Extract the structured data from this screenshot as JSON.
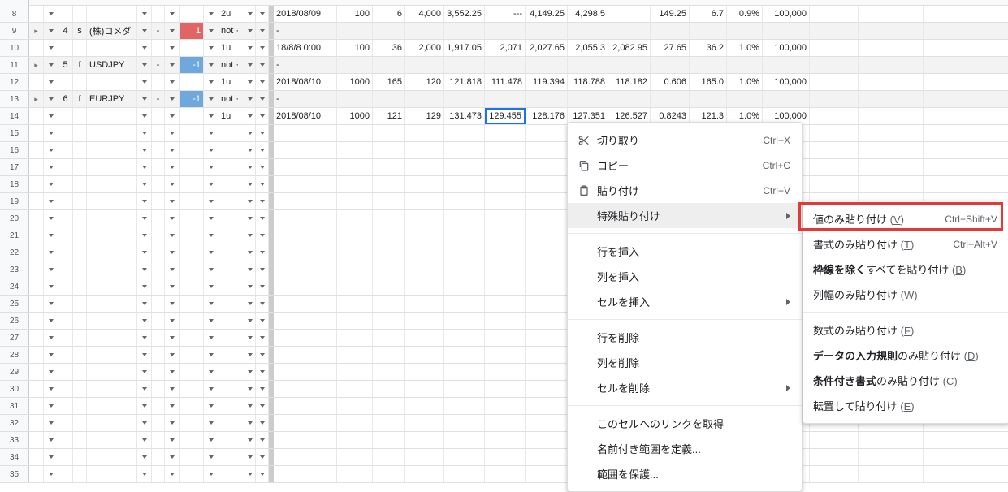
{
  "rows": [
    {
      "num": "8",
      "grey": false,
      "group": false,
      "id": "",
      "type": "",
      "sym": "",
      "bar": "",
      "pos": "",
      "posCls": "",
      "notCell1": false,
      "unit": "2u",
      "date": "2018/08/09",
      "v1": "100",
      "v2": "6",
      "v3": "4,000",
      "v4": "3,552.25",
      "v5": "---",
      "v6": "4,149.25",
      "v7": "4,298.5",
      "v8": "",
      "v9": "149.25",
      "v10": "6.7",
      "v11": "0.9%",
      "v12": "100,000"
    },
    {
      "num": "9",
      "grey": true,
      "group": true,
      "id": "4",
      "type": "s",
      "sym": "(株)コメダ",
      "bar": "-",
      "pos": "1",
      "posCls": "bg-red",
      "notCell1": true,
      "unit": "",
      "date": "-",
      "v1": "",
      "v2": "",
      "v3": "",
      "v4": "",
      "v5": "",
      "v6": "",
      "v7": "",
      "v8": "",
      "v9": "",
      "v10": "",
      "v11": "",
      "v12": ""
    },
    {
      "num": "10",
      "grey": false,
      "group": false,
      "id": "",
      "type": "",
      "sym": "",
      "bar": "",
      "pos": "",
      "posCls": "",
      "notCell1": false,
      "unit": "1u",
      "date": "18/8/8 0:00",
      "v1": "100",
      "v2": "36",
      "v3": "2,000",
      "v4": "1,917.05",
      "v5": "2,071",
      "v6": "2,027.65",
      "v7": "2,055.3",
      "v8": "2,082.95",
      "v9": "27.65",
      "v10": "36.2",
      "v11": "1.0%",
      "v12": "100,000"
    },
    {
      "num": "11",
      "grey": true,
      "group": true,
      "id": "5",
      "type": "f",
      "sym": "USDJPY",
      "bar": "-",
      "pos": "-1",
      "posCls": "bg-blue",
      "notCell1": true,
      "unit": "",
      "date": "-",
      "v1": "",
      "v2": "",
      "v3": "",
      "v4": "",
      "v5": "",
      "v6": "",
      "v7": "",
      "v8": "",
      "v9": "",
      "v10": "",
      "v11": "",
      "v12": ""
    },
    {
      "num": "12",
      "grey": false,
      "group": false,
      "id": "",
      "type": "",
      "sym": "",
      "bar": "",
      "pos": "",
      "posCls": "",
      "notCell1": false,
      "unit": "1u",
      "date": "2018/08/10",
      "v1": "1000",
      "v2": "165",
      "v3": "120",
      "v4": "121.818",
      "v5": "111.478",
      "v6": "119.394",
      "v7": "118.788",
      "v8": "118.182",
      "v9": "0.606",
      "v10": "165.0",
      "v11": "1.0%",
      "v12": "100,000"
    },
    {
      "num": "13",
      "grey": true,
      "group": true,
      "id": "6",
      "type": "f",
      "sym": "EURJPY",
      "bar": "-",
      "pos": "-1",
      "posCls": "bg-blue",
      "notCell1": true,
      "unit": "",
      "date": "-",
      "v1": "",
      "v2": "",
      "v3": "",
      "v4": "",
      "v5": "",
      "v6": "",
      "v7": "",
      "v8": "",
      "v9": "",
      "v10": "",
      "v11": "",
      "v12": ""
    },
    {
      "num": "14",
      "grey": false,
      "group": false,
      "id": "",
      "type": "",
      "sym": "",
      "bar": "",
      "pos": "",
      "posCls": "",
      "notCell1": false,
      "unit": "1u",
      "date": "2018/08/10",
      "v1": "1000",
      "v2": "121",
      "v3": "129",
      "v4": "131.473",
      "v5": "129.455",
      "v6": "128.176",
      "v7": "127.351",
      "v8": "126.527",
      "v9": "0.8243",
      "v10": "121.3",
      "v11": "1.0%",
      "v12": "100,000",
      "selectedCol": "v5"
    }
  ],
  "emptyRows": [
    "15",
    "16",
    "17",
    "18",
    "19",
    "20",
    "21",
    "22",
    "23",
    "24",
    "25",
    "26",
    "27",
    "28",
    "29",
    "30",
    "31",
    "32",
    "33",
    "34",
    "35"
  ],
  "menu1": {
    "cut": {
      "label": "切り取り",
      "short": "Ctrl+X"
    },
    "copy": {
      "label": "コピー",
      "short": "Ctrl+C"
    },
    "paste": {
      "label": "貼り付け",
      "short": "Ctrl+V"
    },
    "pasteSpecial": {
      "label": "特殊貼り付け"
    },
    "insertRow": {
      "label": "行を挿入"
    },
    "insertCol": {
      "label": "列を挿入"
    },
    "insertCells": {
      "label": "セルを挿入"
    },
    "deleteRow": {
      "label": "行を削除"
    },
    "deleteCol": {
      "label": "列を削除"
    },
    "deleteCells": {
      "label": "セルを削除"
    },
    "getLink": {
      "label": "このセルへのリンクを取得"
    },
    "namedRange": {
      "label": "名前付き範囲を定義..."
    },
    "protect": {
      "label": "範囲を保護..."
    }
  },
  "menu2": {
    "pasteValues": {
      "label": "値のみ貼り付け",
      "hotkey": "V",
      "short": "Ctrl+Shift+V"
    },
    "pasteFormat": {
      "label": "書式のみ貼り付け",
      "hotkey": "T",
      "short": "Ctrl+Alt+V"
    },
    "pasteNoBorder": {
      "pre": "枠線を除く",
      "label": "すべてを貼り付け",
      "hotkey": "B"
    },
    "pasteColWidth": {
      "label": "列幅のみ貼り付け",
      "hotkey": "W"
    },
    "pasteFormula": {
      "label": "数式のみ貼り付け",
      "hotkey": "F"
    },
    "pasteValidation": {
      "pre": "データの入力規則",
      "label": "のみ貼り付け",
      "hotkey": "D"
    },
    "pasteCondFmt": {
      "pre": "条件付き書式",
      "label": "のみ貼り付け",
      "hotkey": "C"
    },
    "pasteTranspose": {
      "label": "転置して貼り付け",
      "hotkey": "E"
    }
  }
}
